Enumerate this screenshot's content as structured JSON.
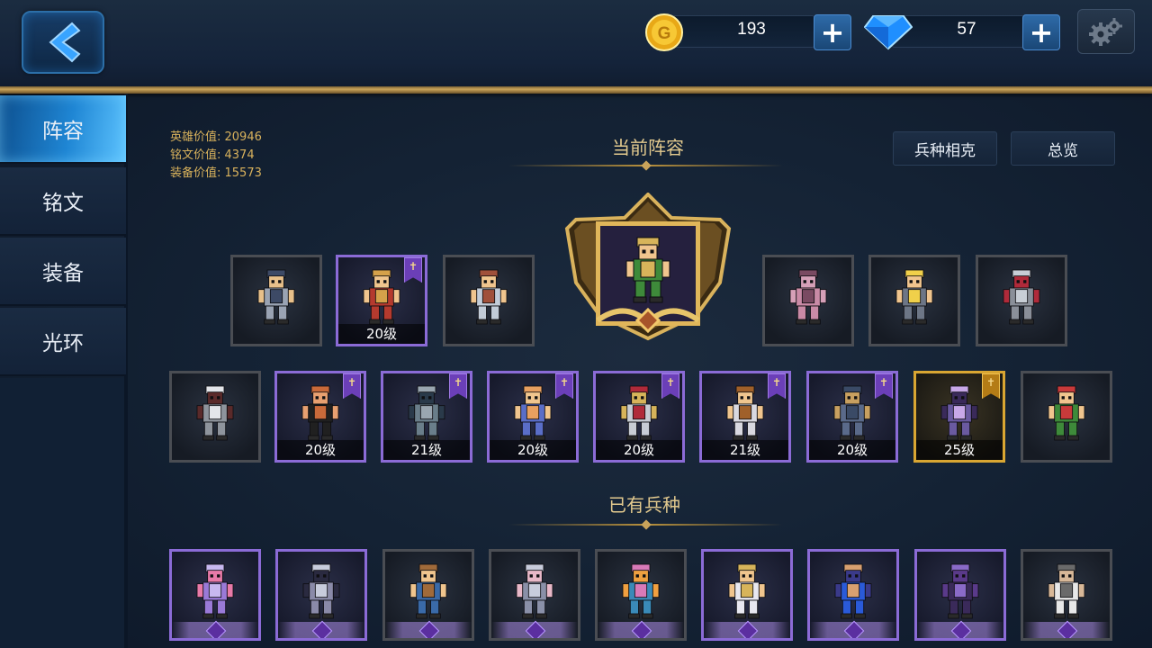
{
  "currency": {
    "gold": {
      "value": "193",
      "icon": "gold-coin-icon"
    },
    "gems": {
      "value": "57",
      "icon": "diamond-icon"
    }
  },
  "tabs": [
    {
      "label": "阵容",
      "active": true
    },
    {
      "label": "铭文",
      "active": false
    },
    {
      "label": "装备",
      "active": false
    },
    {
      "label": "光环",
      "active": false
    }
  ],
  "stats": {
    "hero_value": "英雄价值: 20946",
    "inscription_value": "铭文价值: 4374",
    "equipment_value": "装备价值: 15573"
  },
  "formation": {
    "title": "当前阵容",
    "counter_button": "兵种相克",
    "overview_button": "总览",
    "row1_left": [
      {
        "level": "",
        "rarity": "grey",
        "flag": false,
        "palette": [
          "#9aa3b3",
          "#3d4a66",
          "#e8c08a"
        ]
      },
      {
        "level": "20级",
        "rarity": "purple",
        "flag": true,
        "palette": [
          "#b53a2e",
          "#d5a14a",
          "#f0c58e"
        ]
      },
      {
        "level": "",
        "rarity": "grey",
        "flag": false,
        "palette": [
          "#c2ccd8",
          "#a0503a",
          "#f0c58e"
        ]
      }
    ],
    "captain": {
      "palette": [
        "#3e8a3a",
        "#d7b45a",
        "#f0c58e"
      ]
    },
    "row1_right": [
      {
        "level": "",
        "rarity": "grey",
        "flag": false,
        "palette": [
          "#c98aa6",
          "#7a4a62",
          "#d6a0b8"
        ]
      },
      {
        "level": "",
        "rarity": "grey",
        "flag": false,
        "palette": [
          "#6d7686",
          "#f0d04a",
          "#f0c58e"
        ]
      },
      {
        "level": "",
        "rarity": "grey",
        "flag": false,
        "palette": [
          "#8a8f99",
          "#c8ced6",
          "#b02a3a"
        ]
      }
    ],
    "row2": [
      {
        "level": "",
        "rarity": "grey",
        "flag": false,
        "palette": [
          "#8e949c",
          "#e4e6ea",
          "#5a2a2a"
        ]
      },
      {
        "level": "20级",
        "rarity": "purple",
        "flag": true,
        "palette": [
          "#202020",
          "#c96a3a",
          "#e8a070"
        ]
      },
      {
        "level": "21级",
        "rarity": "purple",
        "flag": true,
        "palette": [
          "#6a7e8a",
          "#9aa6b0",
          "#2a3a4a"
        ]
      },
      {
        "level": "20级",
        "rarity": "purple",
        "flag": true,
        "palette": [
          "#5a6ec8",
          "#e8a060",
          "#f0c58e"
        ]
      },
      {
        "level": "20级",
        "rarity": "purple",
        "flag": true,
        "palette": [
          "#c8ccd4",
          "#b02a3a",
          "#d7b45a"
        ]
      },
      {
        "level": "21级",
        "rarity": "purple",
        "flag": true,
        "palette": [
          "#d8d8e0",
          "#a0602a",
          "#f0c58e"
        ]
      },
      {
        "level": "20级",
        "rarity": "purple",
        "flag": true,
        "palette": [
          "#5a6a8a",
          "#3a4a66",
          "#c8a060"
        ]
      },
      {
        "level": "25级",
        "rarity": "gold",
        "flag": true,
        "palette": [
          "#6a5aa0",
          "#c8a8e8",
          "#3a2a5a"
        ]
      },
      {
        "level": "",
        "rarity": "grey",
        "flag": false,
        "palette": [
          "#3e8a3a",
          "#c83a3a",
          "#f0c58e"
        ]
      }
    ]
  },
  "owned": {
    "title": "已有兵种",
    "units": [
      {
        "rarity": "purple",
        "palette": [
          "#9a7ad8",
          "#c8b8f0",
          "#e87aa8"
        ]
      },
      {
        "rarity": "purple",
        "palette": [
          "#8a8aa8",
          "#c8ccdc",
          "#2a2a40"
        ]
      },
      {
        "rarity": "grey",
        "palette": [
          "#3a6aa8",
          "#a06a3a",
          "#f0c58e"
        ]
      },
      {
        "rarity": "grey",
        "palette": [
          "#8a90a8",
          "#c8ccdc",
          "#e8b8c8"
        ]
      },
      {
        "rarity": "grey",
        "palette": [
          "#3a8ab8",
          "#d87ab8",
          "#f0a040"
        ]
      },
      {
        "rarity": "purple",
        "palette": [
          "#e8e8f0",
          "#d7b45a",
          "#f0c58e"
        ]
      },
      {
        "rarity": "purple",
        "palette": [
          "#2a5ad8",
          "#d8a070",
          "#3a3a8a"
        ]
      },
      {
        "rarity": "purple",
        "palette": [
          "#3a2a5a",
          "#8a6ac8",
          "#5a3a8a"
        ]
      },
      {
        "rarity": "grey",
        "palette": [
          "#e8e8e8",
          "#6a6a6a",
          "#d8b898"
        ]
      }
    ]
  },
  "colors": {
    "accent_blue": "#1f86d4",
    "gold": "#c9a35a",
    "epic_purple": "#8b6bd6",
    "legend_gold": "#d9a632"
  }
}
